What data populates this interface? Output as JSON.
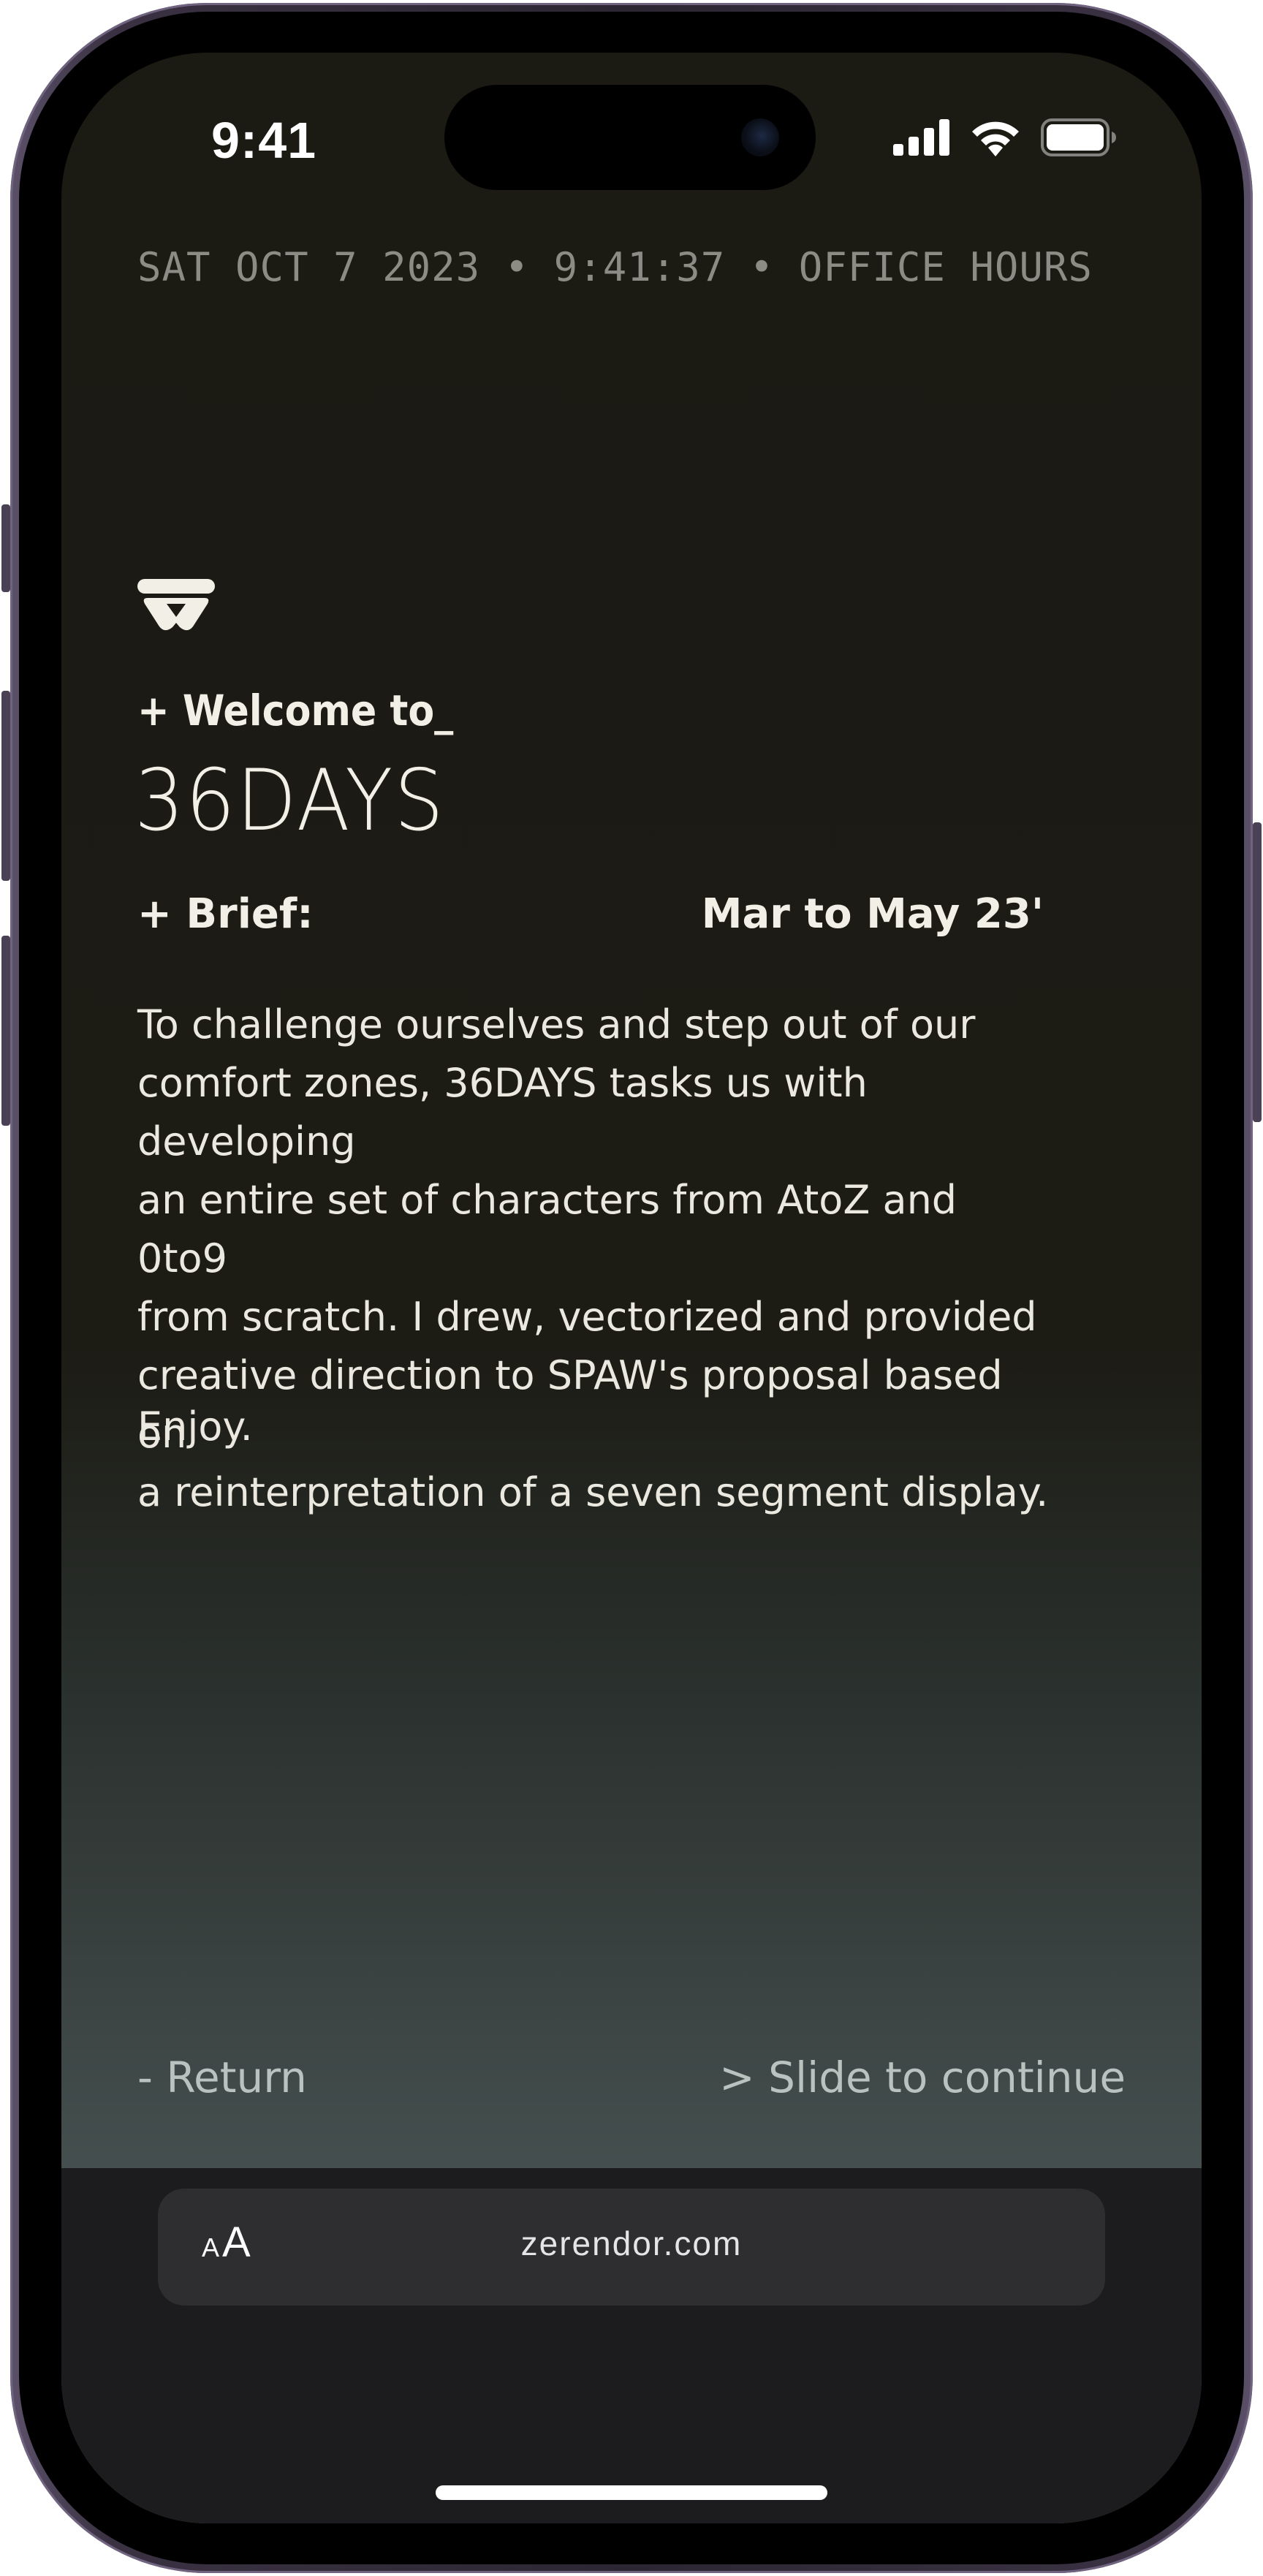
{
  "status_bar": {
    "time": "9:41",
    "icons": [
      "cellular-signal-icon",
      "wifi-icon",
      "battery-icon"
    ]
  },
  "page": {
    "meta_line": "SAT OCT 7 2023 • 9:41:37 • OFFICE HOURS",
    "logo_icon": "spaw-logo-icon",
    "welcome": "+ Welcome to_",
    "title": "36DAYS",
    "brief_label": "+ Brief:",
    "brief_dates": "Mar to May 23'",
    "body_lines": [
      "To challenge ourselves and step out of our",
      "comfort zones, 36DAYS tasks us with developing",
      "an entire set of characters from AtoZ and 0to9",
      "from scratch. I drew, vectorized and provided",
      "creative direction to SPAW's proposal based on",
      "a reinterpretation of a seven segment display."
    ],
    "closing": "Enjoy.",
    "return_link": "- Return",
    "continue_link": "> Slide to continue"
  },
  "browser": {
    "aa_small": "A",
    "aa_big": "A",
    "url": "zerendor.com"
  },
  "colors": {
    "background_top": "#1b1a13",
    "background_bottom": "#566566",
    "text_primary": "#f1efe6",
    "text_muted": "#8c8b84",
    "link": "#b9c2bf"
  }
}
